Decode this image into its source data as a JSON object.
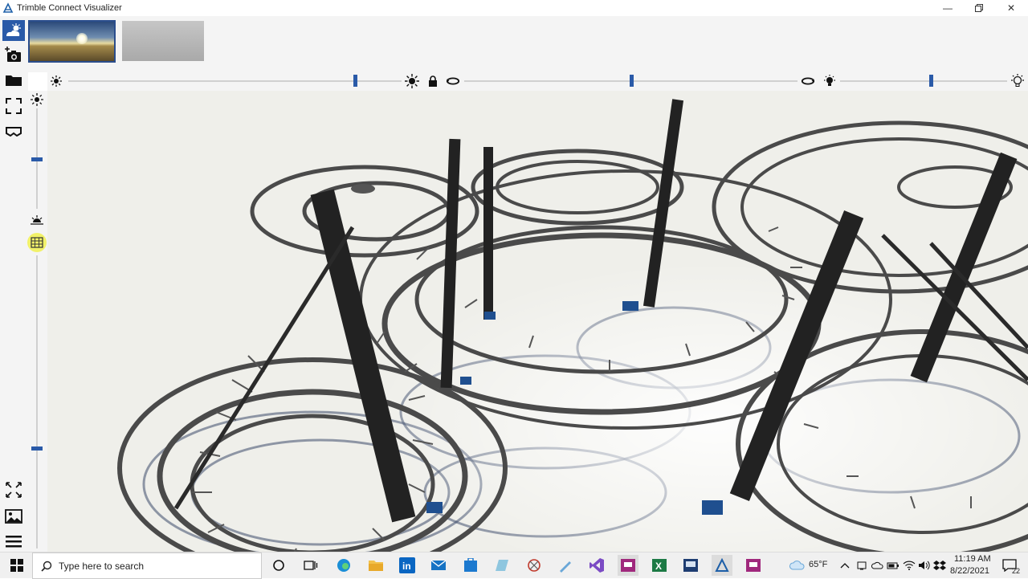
{
  "window": {
    "title": "Trimble Connect Visualizer"
  },
  "window_controls": [
    "minimize-icon",
    "restore-icon",
    "close-icon"
  ],
  "environment_thumbnails": [
    {
      "name": "sky-environment",
      "selected": true
    },
    {
      "name": "grey-environment",
      "selected": false
    }
  ],
  "left_toolbar": [
    "environment-icon",
    "camera-add-icon",
    "folder-icon",
    "fullscreen-icon",
    "vr-headset-icon"
  ],
  "left_toolbar_bottom": [
    "expand-view-icon",
    "image-icon",
    "menu-icon"
  ],
  "sliders": {
    "sun_intensity": 0.86,
    "vertical_top": 0.2,
    "vertical_bottom": 0.85,
    "sun_rotation": 0.5,
    "light_intensity": 0.52
  },
  "taskbar": {
    "search_placeholder": "Type here to search",
    "weather": "65°F",
    "time": "11:19 AM",
    "date": "8/22/2021",
    "notifications": "22"
  },
  "colors": {
    "accent": "#2a5aa8",
    "panel": "#f4f4f4",
    "viewport": "#eeeee9"
  }
}
